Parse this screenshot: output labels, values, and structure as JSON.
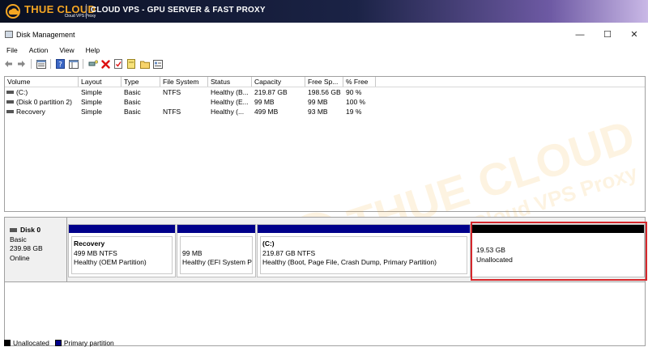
{
  "banner": {
    "brand": "THUE CLOUD",
    "brand_sub": "Cloud VPS Proxy",
    "tagline": "CLOUD VPS - GPU SERVER & FAST PROXY"
  },
  "window": {
    "title": "Disk Management",
    "controls": {
      "minimize": "—",
      "maximize": "☐",
      "close": "✕"
    }
  },
  "menu": [
    "File",
    "Action",
    "View",
    "Help"
  ],
  "toolbar_icons": [
    "back-icon",
    "forward-icon",
    "properties-icon",
    "help-icon",
    "list-view-icon",
    "rescan-icon",
    "delete-icon",
    "check-icon",
    "new-volume-icon",
    "folder-icon",
    "volume-list-icon"
  ],
  "volumes": {
    "columns": [
      "Volume",
      "Layout",
      "Type",
      "File System",
      "Status",
      "Capacity",
      "Free Sp...",
      "% Free"
    ],
    "rows": [
      [
        "(C:)",
        "Simple",
        "Basic",
        "NTFS",
        "Healthy (B...",
        "219.87 GB",
        "198.56 GB",
        "90 %"
      ],
      [
        "(Disk 0 partition 2)",
        "Simple",
        "Basic",
        "",
        "Healthy (E...",
        "99 MB",
        "99 MB",
        "100 %"
      ],
      [
        "Recovery",
        "Simple",
        "Basic",
        "NTFS",
        "Healthy (...",
        "499 MB",
        "93 MB",
        "19 %"
      ]
    ]
  },
  "disk": {
    "name": "Disk 0",
    "type": "Basic",
    "size": "239.98 GB",
    "status": "Online",
    "partitions": [
      {
        "name": "Recovery",
        "size_fs": "499 MB NTFS",
        "status": "Healthy (OEM Partition)"
      },
      {
        "name": "",
        "size_fs": "99 MB",
        "status": "Healthy (EFI System Par"
      },
      {
        "name": "(C:)",
        "size_fs": "219.87 GB NTFS",
        "status": "Healthy (Boot, Page File, Crash Dump, Primary Partition)"
      },
      {
        "name": "",
        "size_fs": "19.53 GB",
        "status": "Unallocated"
      }
    ]
  },
  "legend": {
    "unallocated": "Unallocated",
    "primary": "Primary partition"
  },
  "colors": {
    "primary_bar": "#00008b",
    "unallocated_bar": "#000000",
    "highlight": "#d6272b",
    "brand_orange": "#f5a623"
  },
  "watermark": {
    "brand": "THUE CLOUD",
    "sub": "Cloud VPS Proxy"
  }
}
